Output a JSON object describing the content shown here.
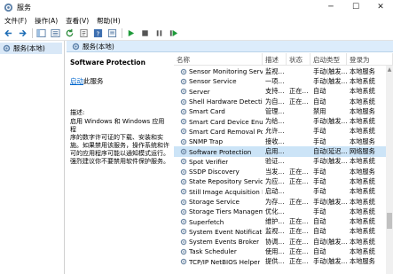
{
  "window": {
    "title": "服务",
    "minimize": "─",
    "maximize": "☐",
    "close": "✕"
  },
  "menus": [
    "文件(F)",
    "操作(A)",
    "查看(V)",
    "帮助(H)"
  ],
  "tree": {
    "root": "服务(本地)"
  },
  "panel": {
    "header": "服务(本地)"
  },
  "description": {
    "service_name": "Software Protection",
    "start_link": "启动",
    "start_suffix": "此服务",
    "label": "描述:",
    "lines": [
      "启用 Windows 和 Windows 应用程",
      "序的数字许可证的下载、安装和实",
      "施。如果禁用该服务，操作系统和许",
      "可的应用程序可能以通知模式运行。",
      "强烈建议你不要禁用软件保护服务。"
    ]
  },
  "columns": [
    "名称",
    "描述",
    "状态",
    "启动类型",
    "登录为"
  ],
  "rows": [
    [
      "Sensor Monitoring Service",
      "监视…",
      "",
      "手动(触发…",
      "本地服务"
    ],
    [
      "Sensor Service",
      "一项…",
      "",
      "手动(触发…",
      "本地系统"
    ],
    [
      "Server",
      "支持…",
      "正在…",
      "自动",
      "本地系统"
    ],
    [
      "Shell Hardware Detection",
      "为自…",
      "正在…",
      "自动",
      "本地系统"
    ],
    [
      "Smart Card",
      "管理…",
      "",
      "禁用",
      "本地服务"
    ],
    [
      "Smart Card Device Enum…",
      "为给…",
      "",
      "手动(触发…",
      "本地系统"
    ],
    [
      "Smart Card Removal Poli…",
      "允许…",
      "",
      "手动",
      "本地系统"
    ],
    [
      "SNMP Trap",
      "接收…",
      "",
      "手动",
      "本地服务"
    ],
    [
      "Software Protection",
      "启用…",
      "",
      "自动(延迟…",
      "网络服务"
    ],
    [
      "Spot Verifier",
      "验证…",
      "",
      "手动(触发…",
      "本地系统"
    ],
    [
      "SSDP Discovery",
      "当发…",
      "正在…",
      "手动",
      "本地服务"
    ],
    [
      "State Repository Service",
      "为应…",
      "正在…",
      "手动",
      "本地系统"
    ],
    [
      "Still Image Acquisition Ev…",
      "启动…",
      "",
      "手动",
      "本地系统"
    ],
    [
      "Storage Service",
      "为存…",
      "正在…",
      "手动(触发…",
      "本地系统"
    ],
    [
      "Storage Tiers Managem…",
      "优化…",
      "",
      "手动",
      "本地系统"
    ],
    [
      "Superfetch",
      "维护…",
      "正在…",
      "自动",
      "本地系统"
    ],
    [
      "System Event Notification…",
      "监视…",
      "正在…",
      "自动",
      "本地系统"
    ],
    [
      "System Events Broker",
      "协调…",
      "正在…",
      "自动(触发…",
      "本地系统"
    ],
    [
      "Task Scheduler",
      "使用…",
      "正在…",
      "自动",
      "本地系统"
    ],
    [
      "TCP/IP NetBIOS Helper",
      "提供…",
      "正在…",
      "手动(触发…",
      "本地服务"
    ]
  ],
  "selected_row": "Software Protection",
  "colors": {
    "selection": "#cce4f7",
    "header": "#dcecfb",
    "link": "#0066cc"
  }
}
